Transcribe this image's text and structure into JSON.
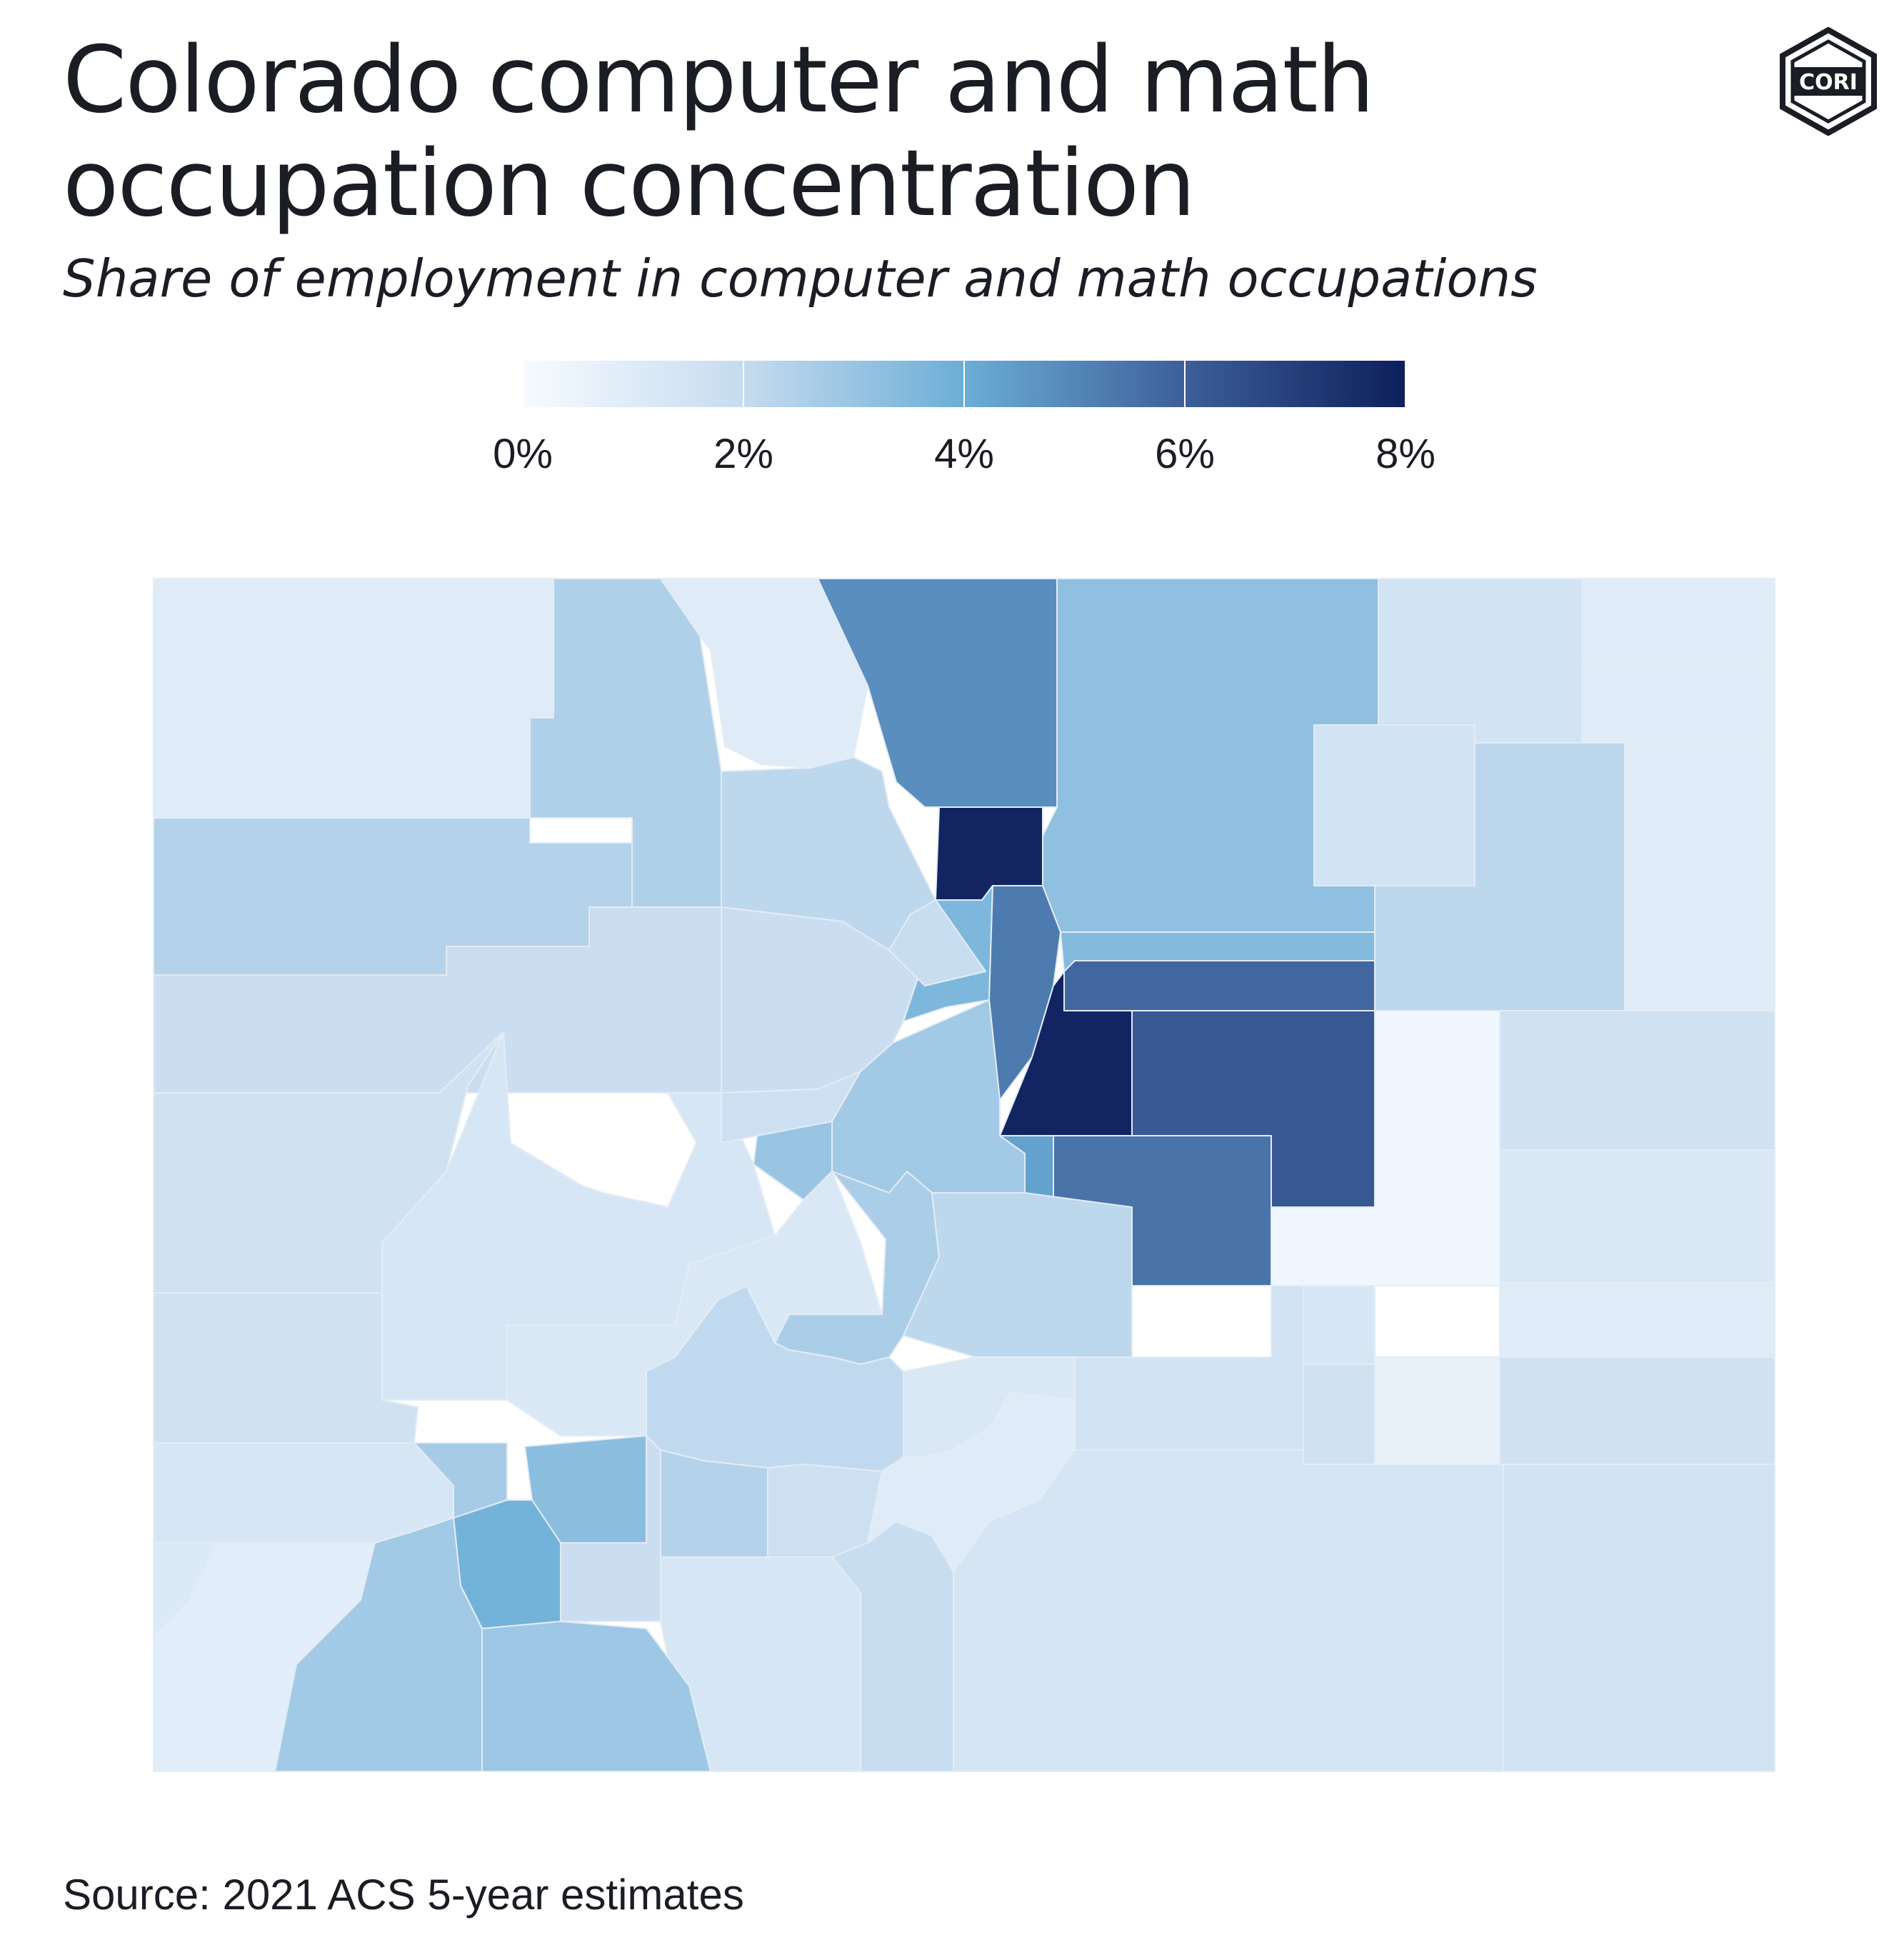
{
  "title": "Colorado computer and math occupation concentration",
  "subtitle": "Share of employment in computer and math occupations",
  "source": "Source: 2021 ACS 5-year estimates",
  "logo": {
    "text": "CORI",
    "icon": "cori-hexagon-logo"
  },
  "legend": {
    "ticks": [
      "0%",
      "2%",
      "4%",
      "6%",
      "8%"
    ],
    "min": 0,
    "max": 8,
    "colors": [
      "#f7fbff",
      "#c6dbef",
      "#6baed6",
      "#3d5f9a",
      "#0d1f5c"
    ]
  },
  "map": {
    "state": "Colorado",
    "regions": [
      {
        "id": "moffat",
        "share": 1.0
      },
      {
        "id": "routt",
        "share": 2.5
      },
      {
        "id": "jackson",
        "share": 1.0
      },
      {
        "id": "larimer",
        "share": 4.8
      },
      {
        "id": "weld",
        "share": 3.2
      },
      {
        "id": "logan",
        "share": 1.5
      },
      {
        "id": "sedgwick",
        "share": 1.0
      },
      {
        "id": "phillips",
        "share": 1.0
      },
      {
        "id": "morgan",
        "share": 1.5
      },
      {
        "id": "washington",
        "share": 2.2
      },
      {
        "id": "yuma",
        "share": 1.0
      },
      {
        "id": "boulder",
        "share": 7.8
      },
      {
        "id": "grand",
        "share": 2.2
      },
      {
        "id": "rio-blanco",
        "share": 2.4
      },
      {
        "id": "garfield",
        "share": 1.8
      },
      {
        "id": "eagle",
        "share": 1.8
      },
      {
        "id": "summit",
        "share": 1.9
      },
      {
        "id": "gilpin-clear-creek",
        "share": 3.6
      },
      {
        "id": "jefferson",
        "share": 5.3
      },
      {
        "id": "adams-broomfield",
        "share": 3.5
      },
      {
        "id": "arapahoe",
        "share": 5.8
      },
      {
        "id": "douglas",
        "share": 7.8
      },
      {
        "id": "elbert",
        "share": 6.2
      },
      {
        "id": "lincoln",
        "share": 0.3
      },
      {
        "id": "kit-carson",
        "share": 1.6
      },
      {
        "id": "mesa",
        "share": 1.6
      },
      {
        "id": "delta",
        "share": 1.3
      },
      {
        "id": "pitkin",
        "share": 1.7
      },
      {
        "id": "lake",
        "share": 3.0
      },
      {
        "id": "park",
        "share": 2.8
      },
      {
        "id": "teller",
        "share": 4.3
      },
      {
        "id": "el-paso",
        "share": 5.5
      },
      {
        "id": "cheyenne",
        "share": 1.2
      },
      {
        "id": "montrose",
        "share": 1.6
      },
      {
        "id": "gunnison",
        "share": 1.2
      },
      {
        "id": "chaffee",
        "share": 2.6
      },
      {
        "id": "fremont",
        "share": 2.2
      },
      {
        "id": "kiowa",
        "share": 1.0
      },
      {
        "id": "san-miguel",
        "share": 1.3
      },
      {
        "id": "ouray",
        "share": 2.7
      },
      {
        "id": "hinsdale",
        "share": 3.3
      },
      {
        "id": "saguache",
        "share": 2.1
      },
      {
        "id": "custer",
        "share": 1.2
      },
      {
        "id": "pueblo",
        "share": 1.5
      },
      {
        "id": "crowley",
        "share": 1.3
      },
      {
        "id": "otero",
        "share": 1.6
      },
      {
        "id": "bent",
        "share": 0.6
      },
      {
        "id": "prowers",
        "share": 1.6
      },
      {
        "id": "dolores",
        "share": 1.1
      },
      {
        "id": "san-juan",
        "share": 3.8
      },
      {
        "id": "montezuma",
        "share": 0.9
      },
      {
        "id": "la-plata",
        "share": 2.8
      },
      {
        "id": "archuleta",
        "share": 2.9
      },
      {
        "id": "mineral",
        "share": 1.8
      },
      {
        "id": "rio-grande",
        "share": 2.4
      },
      {
        "id": "alamosa",
        "share": 1.7
      },
      {
        "id": "conejos",
        "share": 1.3
      },
      {
        "id": "costilla",
        "share": 1.9
      },
      {
        "id": "huerfano",
        "share": 1.0
      },
      {
        "id": "las-animas",
        "share": 1.4
      },
      {
        "id": "baca",
        "share": 1.5
      }
    ]
  }
}
